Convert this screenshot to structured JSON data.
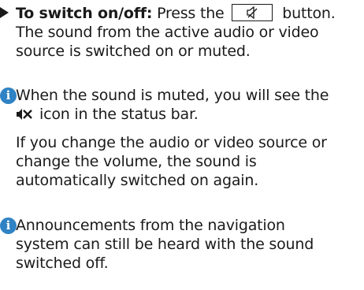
{
  "item_switch": {
    "label": "To switch on/off:",
    "text_before_key": "Press the",
    "key_icon": "speaker-mute-key-icon",
    "text_after_key": "button.",
    "lines": [
      "The sound from the active audio or video",
      "source is switched on or muted."
    ]
  },
  "note_muted": {
    "icon": "info-icon",
    "line1": "When the sound is muted, you will see the",
    "status_icon": "mute-x-icon",
    "line2_after_icon": "icon in the status bar."
  },
  "para_change": {
    "lines": [
      "If you change the audio or video source or",
      "change the volume, the sound is",
      "automatically switched on again."
    ]
  },
  "note_navigation": {
    "icon": "info-icon",
    "lines": [
      "Announcements from the navigation",
      "system can still be heard with the sound",
      "switched off."
    ]
  },
  "colors": {
    "info_icon": "#2f83c4",
    "text": "#1a1a1a"
  }
}
